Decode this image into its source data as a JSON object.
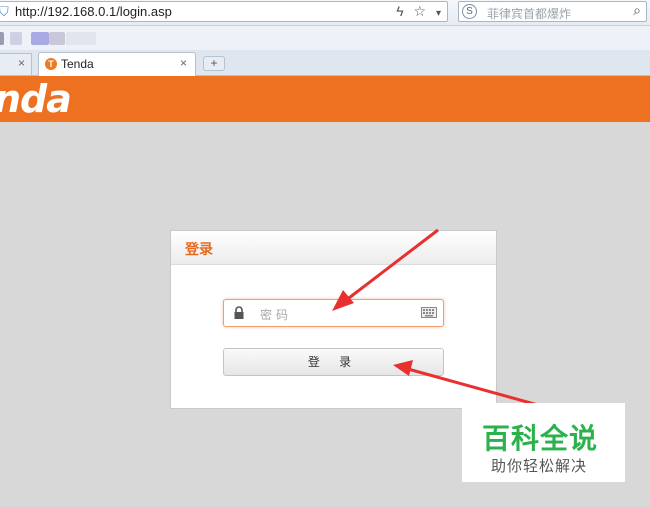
{
  "browser": {
    "url": "http://192.168.0.1/login.asp",
    "search_placeholder": "菲律宾首都爆炸",
    "tab_title": "Tenda",
    "new_tab_label": "+",
    "close_label": "×"
  },
  "page": {
    "brand": "nda",
    "panel_title": "登录",
    "password_placeholder": "密码",
    "login_button": "登 录",
    "accent_color": "#ee7021"
  },
  "watermark": {
    "title": "百科全说",
    "subtitle": "助你轻松解决"
  }
}
